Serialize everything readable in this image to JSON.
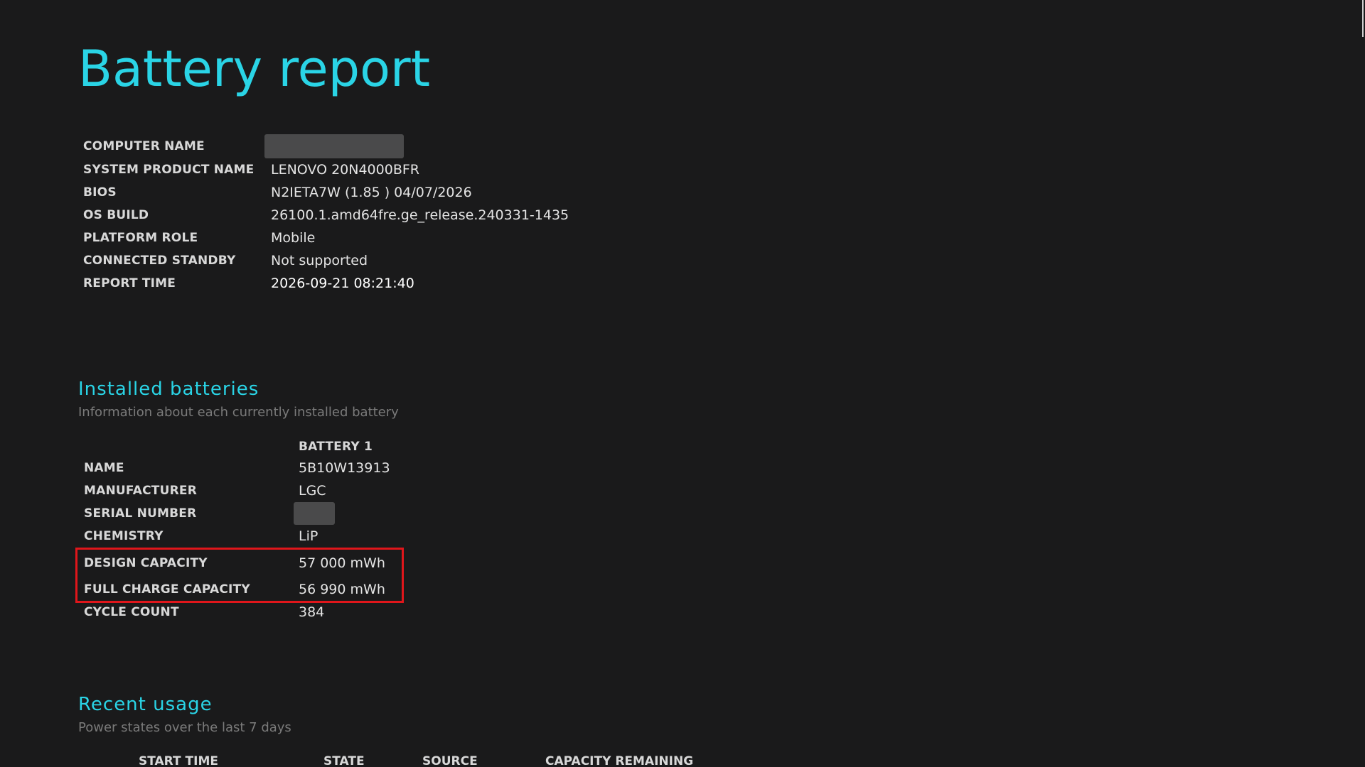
{
  "title": "Battery report",
  "system_info": [
    {
      "label": "COMPUTER NAME",
      "value": "",
      "redacted": true
    },
    {
      "label": "SYSTEM PRODUCT NAME",
      "value": "LENOVO 20N4000BFR"
    },
    {
      "label": "BIOS",
      "value": "N2IETA7W (1.85 ) 04/07/2026"
    },
    {
      "label": "OS BUILD",
      "value": "26100.1.amd64fre.ge_release.240331-1435"
    },
    {
      "label": "PLATFORM ROLE",
      "value": "Mobile"
    },
    {
      "label": "CONNECTED STANDBY",
      "value": "Not supported"
    },
    {
      "label": "REPORT TIME",
      "value": "2026-09-21  08:21:40"
    }
  ],
  "installed_batteries": {
    "title": "Installed batteries",
    "subtitle": "Information about each currently installed battery",
    "column_header": "BATTERY 1",
    "rows": [
      {
        "label": "NAME",
        "value": "5B10W13913"
      },
      {
        "label": "MANUFACTURER",
        "value": "LGC"
      },
      {
        "label": "SERIAL NUMBER",
        "value": "",
        "redacted": true
      },
      {
        "label": "CHEMISTRY",
        "value": "LiP"
      },
      {
        "label": "DESIGN CAPACITY",
        "value": "57 000 mWh"
      },
      {
        "label": "FULL CHARGE CAPACITY",
        "value": "56 990 mWh"
      },
      {
        "label": "CYCLE COUNT",
        "value": "384"
      }
    ],
    "highlight_color": "#e0161b"
  },
  "recent_usage": {
    "title": "Recent usage",
    "subtitle": "Power states over the last 7 days",
    "columns": [
      "START TIME",
      "STATE",
      "SOURCE",
      "CAPACITY REMAINING"
    ]
  },
  "colors": {
    "background": "#1a1a1b",
    "accent": "#2ad4e6",
    "highlight": "#e0161b"
  }
}
